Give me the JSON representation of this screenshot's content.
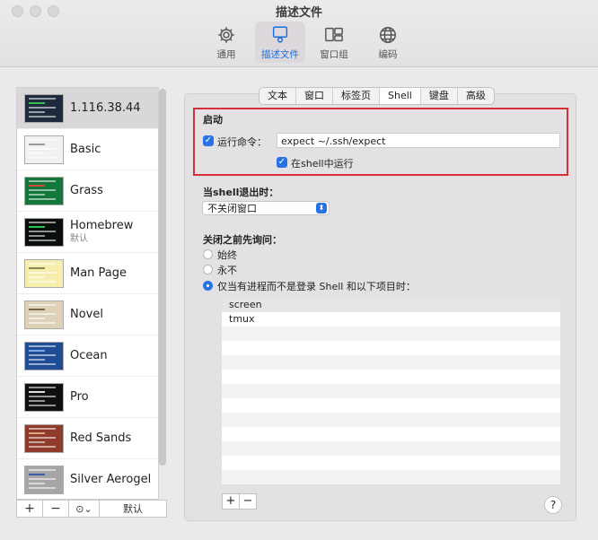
{
  "window": {
    "title": "描述文件"
  },
  "toolbar": [
    {
      "label": "通用",
      "icon": "gear-icon"
    },
    {
      "label": "描述文件",
      "icon": "profiles-icon",
      "active": true
    },
    {
      "label": "窗口组",
      "icon": "window-group-icon"
    },
    {
      "label": "编码",
      "icon": "globe-icon"
    }
  ],
  "profiles": [
    {
      "name": "1.116.38.44",
      "sub": "",
      "bg": "#1d2b3d",
      "accent": "#2fbf4d"
    },
    {
      "name": "Basic",
      "sub": "",
      "bg": "#f1f1f1",
      "accent": "#999999"
    },
    {
      "name": "Grass",
      "sub": "",
      "bg": "#12773a",
      "accent": "#d6453a"
    },
    {
      "name": "Homebrew",
      "sub": "默认",
      "bg": "#0b0f0b",
      "accent": "#2fbf4d"
    },
    {
      "name": "Man Page",
      "sub": "",
      "bg": "#f6eeaf",
      "accent": "#8a8a50"
    },
    {
      "name": "Novel",
      "sub": "",
      "bg": "#ddd2b8",
      "accent": "#7a6850"
    },
    {
      "name": "Ocean",
      "sub": "",
      "bg": "#1f4e97",
      "accent": "#7aa9e6"
    },
    {
      "name": "Pro",
      "sub": "",
      "bg": "#101010",
      "accent": "#dddddd"
    },
    {
      "name": "Red Sands",
      "sub": "",
      "bg": "#8e3b2c",
      "accent": "#e0a57f"
    },
    {
      "name": "Silver Aerogel",
      "sub": "",
      "bg": "#a6a6a6",
      "accent": "#3b5aa6"
    }
  ],
  "sidebar_bottom": {
    "add": "+",
    "remove": "−",
    "more": "⊙⌄",
    "default": "默认"
  },
  "tabs": [
    {
      "label": "文本"
    },
    {
      "label": "窗口"
    },
    {
      "label": "标签页"
    },
    {
      "label": "Shell",
      "active": true
    },
    {
      "label": "键盘"
    },
    {
      "label": "高级"
    }
  ],
  "startup": {
    "heading": "启动",
    "run_command_label": "运行命令：",
    "run_command_value": "expect ~/.ssh/expect",
    "run_in_shell_label": "在shell中运行",
    "check": "✓"
  },
  "shell_exit": {
    "heading_prefix": "当",
    "heading_bold": "shell",
    "heading_suffix": "退出时：",
    "selected": "不关闭窗口",
    "arrow": "⬍"
  },
  "ask_close": {
    "heading": "关闭之前先询问：",
    "options": [
      {
        "label": "始终",
        "selected": false
      },
      {
        "label": "永不",
        "selected": false
      },
      {
        "label": "仅当有进程而不是登录 Shell 和以下项目时：",
        "selected": true
      }
    ],
    "processes": [
      "screen",
      "tmux"
    ]
  },
  "list_buttons": {
    "add": "+",
    "remove": "−"
  },
  "help": "?",
  "colors": {
    "accent": "#2a72e3",
    "highlight": "#d8303a"
  }
}
